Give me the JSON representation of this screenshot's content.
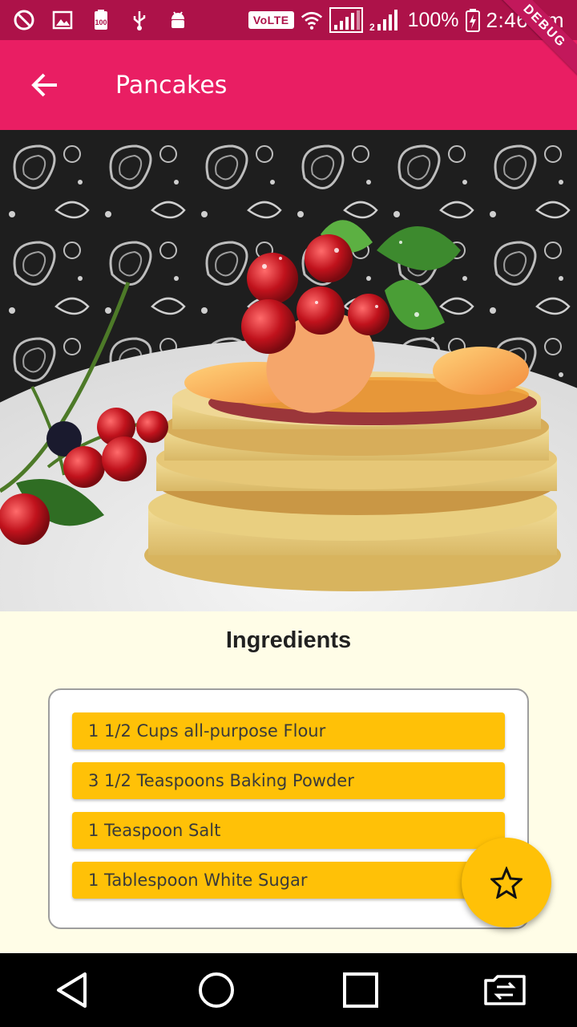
{
  "status_bar": {
    "volte": "VoLTE",
    "battery": "100%",
    "time": "2:46 pm",
    "icons": [
      "do-not-disturb-icon",
      "gallery-icon",
      "battery-100-icon",
      "usb-icon",
      "android-debug-icon",
      "wifi-icon",
      "signal-sim1-icon",
      "signal-sim2-icon",
      "battery-charging-icon"
    ]
  },
  "debug_banner": "DEBUG",
  "app_bar": {
    "title": "Pancakes",
    "back_icon": "arrow-back-icon",
    "color": "#e91e63"
  },
  "hero": {
    "description_icon": "pancakes-photo"
  },
  "ingredients": {
    "title": "Ingredients",
    "items": [
      "1 1/2 Cups all-purpose Flour",
      "3 1/2 Teaspoons Baking Powder",
      "1 Teaspoon Salt",
      "1 Tablespoon White Sugar"
    ],
    "item_color": "#ffc107",
    "background": "#fffde7"
  },
  "fab": {
    "icon": "star-outline-icon",
    "color": "#ffc107"
  },
  "nav_bar": {
    "buttons": [
      "back-triangle-icon",
      "home-circle-icon",
      "recents-square-icon",
      "switch-sim-icon"
    ]
  }
}
